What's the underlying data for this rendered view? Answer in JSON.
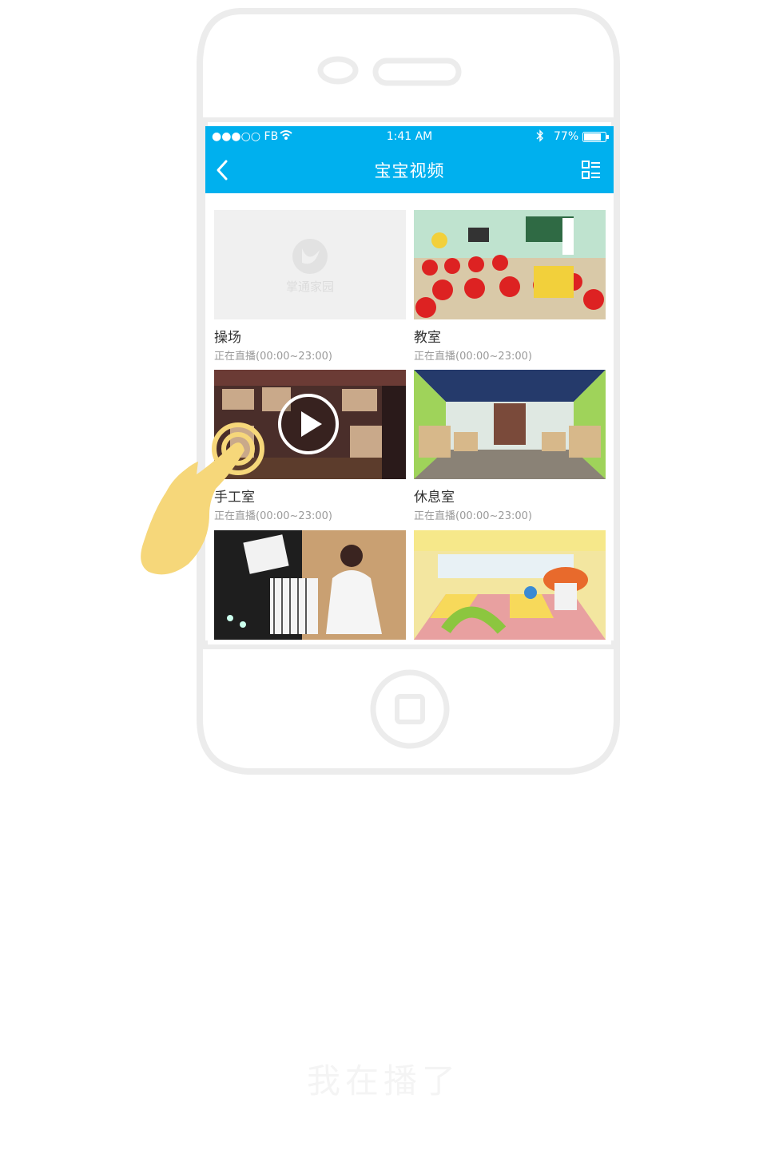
{
  "status_bar": {
    "carrier": "●●●○○ FB",
    "time": "1:41 AM",
    "battery": "77%"
  },
  "nav": {
    "title": "宝宝视频",
    "back_icon": "chevron-left-icon",
    "menu_icon": "list-grid-icon"
  },
  "videos": [
    {
      "name": "操场",
      "status": "正在直播(00:00~23:00)",
      "placeholder_logo": "掌通家园"
    },
    {
      "name": "教室",
      "status": "正在直播(00:00~23:00)"
    },
    {
      "name": "手工室",
      "status": "正在直播(00:00~23:00)"
    },
    {
      "name": "休息室",
      "status": "正在直播(00:00~23:00)"
    },
    {
      "name": "",
      "status": ""
    },
    {
      "name": "",
      "status": ""
    }
  ],
  "caption": "我在播了",
  "colors": {
    "accent": "#00b0ee",
    "hand": "#f6d77a",
    "frame_stroke": "#ececec"
  }
}
